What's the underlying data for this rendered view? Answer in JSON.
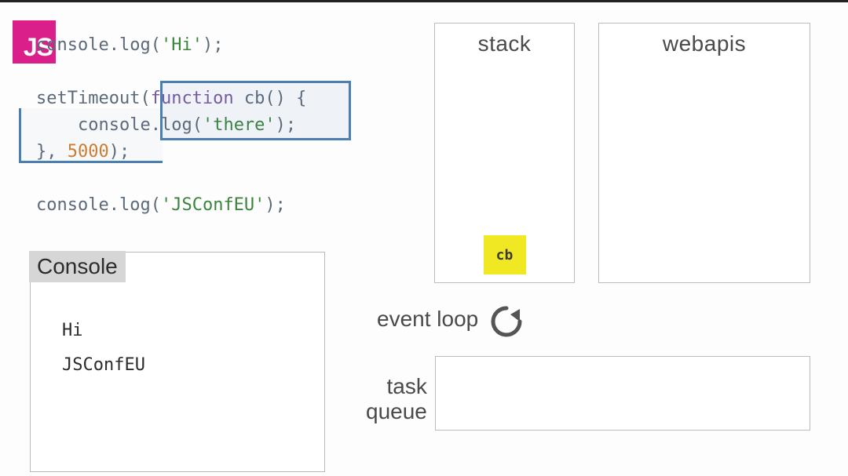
{
  "logo": {
    "text": "JS"
  },
  "code": {
    "line1": {
      "ident": "console",
      "dot": ".",
      "method": "log",
      "open": "(",
      "str": "'Hi'",
      "close": ");"
    },
    "line2": {
      "ident": "setTimeout",
      "open": "(",
      "key": "function",
      "space": " ",
      "cbname": "cb",
      "parens": "()",
      "brace": " {"
    },
    "line3": {
      "indent": "    ",
      "ident": "console",
      "dot": ".",
      "method": "log",
      "open": "(",
      "str": "'there'",
      "close": ");"
    },
    "line4": {
      "close_brace": "}",
      "comma": ", ",
      "num": "5000",
      "close": ");"
    },
    "line5": {
      "ident": "console",
      "dot": ".",
      "method": "log",
      "open": "(",
      "str": "'JSConfEU'",
      "close": ");"
    }
  },
  "console": {
    "title": "Console",
    "output": [
      "Hi",
      "JSConfEU"
    ]
  },
  "stack": {
    "title": "stack",
    "frames": [
      "cb"
    ]
  },
  "webapis": {
    "title": "webapis"
  },
  "event_loop": {
    "label": "event loop"
  },
  "task_queue": {
    "label_line1": "task",
    "label_line2": "queue"
  }
}
